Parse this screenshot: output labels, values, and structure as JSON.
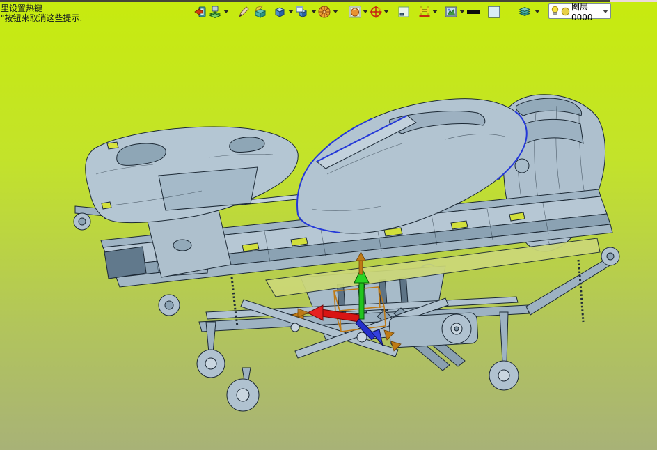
{
  "window": {
    "top_strip_color": "#45453a",
    "top_strip_accent_color": "#ecd9d9"
  },
  "hint": {
    "line1": "里设置热键",
    "line2": "\"按钮来取消这些提示."
  },
  "toolbar": {
    "icons": [
      {
        "name": "exit-confirm-icon",
        "has_dropdown": false
      },
      {
        "name": "insert-component-icon",
        "has_dropdown": true
      },
      {
        "name": "sketch-pen-icon",
        "has_dropdown": false
      },
      {
        "name": "open-box-icon",
        "has_dropdown": false
      },
      {
        "name": "solid-cube-icon",
        "has_dropdown": true
      },
      {
        "name": "cube-window-icon",
        "has_dropdown": true
      },
      {
        "name": "render-wheel-icon",
        "has_dropdown": true
      },
      {
        "name": "material-sphere-icon",
        "has_dropdown": true
      },
      {
        "name": "target-compass-icon",
        "has_dropdown": true
      },
      {
        "name": "canvas-frame-icon",
        "has_dropdown": false
      },
      {
        "name": "dimension-h-icon",
        "has_dropdown": true
      },
      {
        "name": "scene-render-icon",
        "has_dropdown": true
      },
      {
        "name": "thickness-bar-icon",
        "has_dropdown": false
      },
      {
        "name": "blank-square-icon",
        "has_dropdown": false
      },
      {
        "name": "suppress-layers-icon",
        "has_dropdown": true
      }
    ]
  },
  "layer_combo": {
    "visibility_icon": "lightbulb-icon",
    "color_swatch_icon": "layer-color-swatch",
    "value": "图层0000"
  },
  "viewport": {
    "description": "3D CAD model of hospital bed with casters, side-rail panels and footboard",
    "background_top": "#c7eb0e",
    "background_bottom": "#a8b277",
    "model_fill": "#b2c4d1",
    "model_fill_dark": "#8da4b5",
    "model_fill_light": "#c9d6e0",
    "outline_color": "#1c2935",
    "selection_highlight": "#2438d8",
    "deck_highlight": "#ccd878",
    "hole_highlight": "#d2df3a",
    "triad": {
      "x_axis_color": "#d81414",
      "y_axis_color": "#22c41e",
      "z_axis_color": "#2530cc",
      "manipulator_color": "#bf7a16"
    }
  }
}
